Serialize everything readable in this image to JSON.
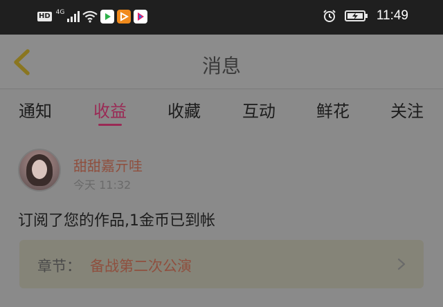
{
  "status_bar": {
    "hd_label": "HD",
    "network_label": "4G",
    "time": "11:49",
    "app_icons": [
      "player-icon",
      "play-orange-icon",
      "video-app-icon"
    ]
  },
  "nav": {
    "title": "消息"
  },
  "tabs": [
    {
      "label": "通知",
      "active": false
    },
    {
      "label": "收益",
      "active": true
    },
    {
      "label": "收藏",
      "active": false
    },
    {
      "label": "互动",
      "active": false
    },
    {
      "label": "鲜花",
      "active": false
    },
    {
      "label": "关注",
      "active": false
    }
  ],
  "message_item": {
    "user_name": "甜甜嘉亓哇",
    "timestamp": "今天 11:32",
    "text": "订阅了您的作品,1金币已到帐",
    "chapter_label": "章节：",
    "chapter_title": "备战第二次公演"
  },
  "colors": {
    "accent": "#9a2a55",
    "back_arrow": "#8a7620",
    "username": "#8f4f3e"
  }
}
